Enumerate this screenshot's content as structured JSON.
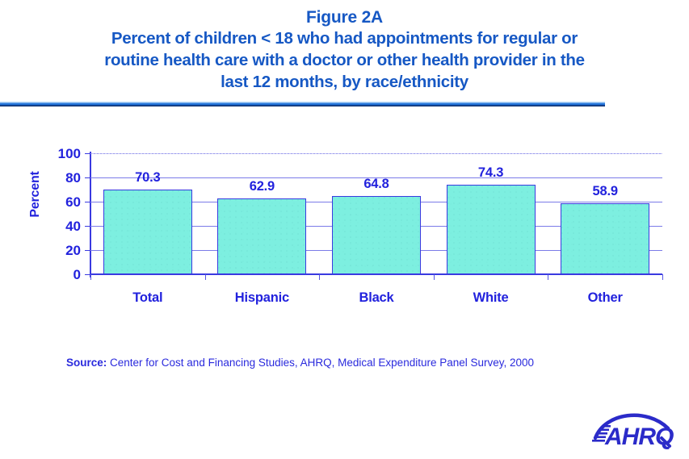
{
  "title": {
    "line1": "Figure 2A",
    "line2": "Percent of children < 18 who had appointments for regular or",
    "line3": "routine health care with a doctor or other health provider in the",
    "line4": "last 12 months, by race/ethnicity"
  },
  "source": {
    "label": "Source:",
    "text": " Center for Cost and Financing Studies, AHRQ, Medical Expenditure Panel Survey, 2000"
  },
  "logo": {
    "text": "AHRQ",
    "name": "ahrq-logo"
  },
  "colors": {
    "title": "#1658c4",
    "chart_text": "#2222dd",
    "bar_fill": "#7defe0",
    "bar_border": "#3a3ae0",
    "gridline": "#7b7be8",
    "divider": "#1f6fd6"
  },
  "chart_data": {
    "type": "bar",
    "title": "Percent of children < 18 who had appointments for regular or routine health care with a doctor or other health provider in the last 12 months, by race/ethnicity",
    "subtitle": "Figure 2A",
    "categories": [
      "Total",
      "Hispanic",
      "Black",
      "White",
      "Other"
    ],
    "values": [
      70.3,
      62.9,
      64.8,
      74.3,
      58.9
    ],
    "value_labels": [
      "70.3",
      "62.9",
      "64.8",
      "74.3",
      "58.9"
    ],
    "xlabel": "",
    "ylabel": "Percent",
    "ylim": [
      0,
      100
    ],
    "yticks": [
      0,
      20,
      40,
      60,
      80,
      100
    ],
    "ytick_labels": [
      "0",
      "20",
      "40",
      "60",
      "80",
      "100"
    ],
    "grid": true,
    "legend": false
  }
}
